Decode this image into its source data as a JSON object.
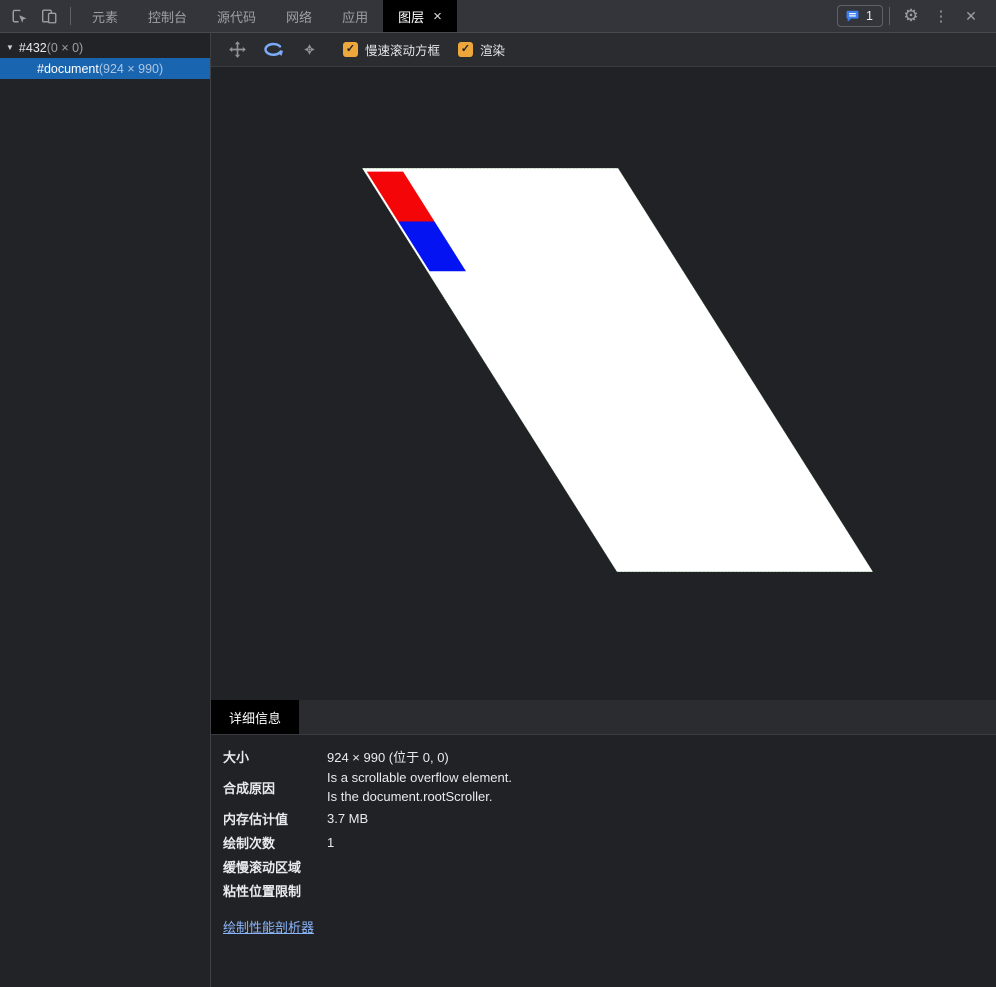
{
  "colors": {
    "accent-blue": "#7cacf8",
    "selection-blue": "#1a65b0",
    "checkbox-orange": "#eda73b",
    "layer-red": "#f40508",
    "layer-blue": "#0413f2",
    "layer-border-green": "#337a36",
    "link-blue": "#8ab4f8",
    "issues-blue": "#3d7ef0"
  },
  "topbar": {
    "tabs": [
      {
        "label": "元素"
      },
      {
        "label": "控制台"
      },
      {
        "label": "源代码"
      },
      {
        "label": "网络"
      },
      {
        "label": "应用"
      },
      {
        "label": "图层",
        "active": true,
        "close": "×"
      }
    ],
    "issues_count": "1"
  },
  "tree": {
    "expander": "▼",
    "root_name": "#432",
    "root_size": "(0 × 0)",
    "doc_name": "#document",
    "doc_size": "(924 × 990)"
  },
  "view_toolbar": {
    "slow_scroll_label": "慢速滚动方框",
    "paints_label": "渲染",
    "check_glyph": "✓"
  },
  "details": {
    "tab_label": "详细信息",
    "rows": {
      "size": {
        "label": "大小",
        "value": "924 × 990  (位于 0, 0)"
      },
      "compositing": {
        "label": "合成原因",
        "line1": "Is a scrollable overflow element.",
        "line2": "Is the document.rootScroller."
      },
      "memory": {
        "label": "内存估计值",
        "value": "3.7 MB"
      },
      "paint_count": {
        "label": "绘制次数",
        "value": "1"
      },
      "slow_scroll": {
        "label": "缓慢滚动区域",
        "value": ""
      },
      "sticky": {
        "label": "粘性位置限制",
        "value": ""
      }
    },
    "profiler_link": "绘制性能剖析器"
  },
  "glyphs": {
    "gear": "⚙",
    "kebab": "⋮",
    "close": "✕"
  }
}
